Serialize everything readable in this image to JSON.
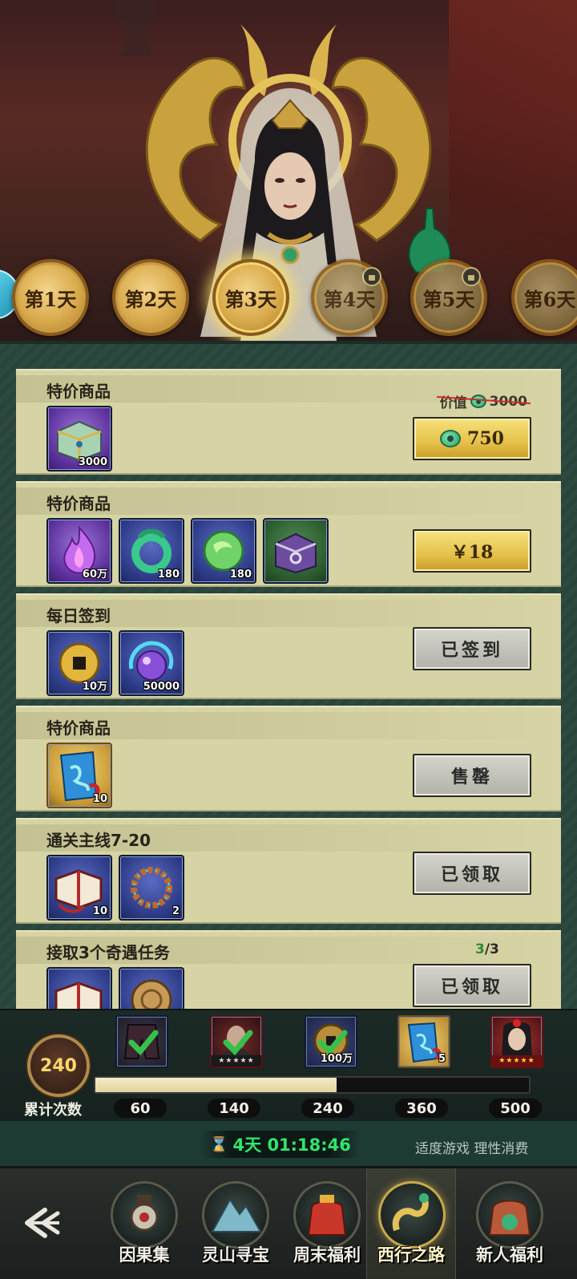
{
  "days": [
    {
      "label": "第1天",
      "state": "claimed"
    },
    {
      "label": "第2天",
      "state": "claimed"
    },
    {
      "label": "第3天",
      "state": "active"
    },
    {
      "label": "第4天",
      "state": "locked"
    },
    {
      "label": "第5天",
      "state": "locked"
    },
    {
      "label": "第6天",
      "state": "locked"
    }
  ],
  "tasks": [
    {
      "title": "特价商品",
      "original_price_label": "价值",
      "original_price_value": "3000",
      "items": [
        {
          "icon": "jade-chest-icon",
          "qty": "3000"
        }
      ],
      "button": {
        "label": "750",
        "style": "gold",
        "currency_icon": "jade-coin-icon"
      }
    },
    {
      "title": "特价商品",
      "items": [
        {
          "icon": "purple-flame-icon",
          "qty": "60万"
        },
        {
          "icon": "jade-dragon-ring-icon",
          "qty": "180"
        },
        {
          "icon": "jade-orb-icon",
          "qty": "180"
        },
        {
          "icon": "purple-chest-icon",
          "qty": ""
        }
      ],
      "button": {
        "label": "￥18",
        "style": "gold"
      }
    },
    {
      "title": "每日签到",
      "items": [
        {
          "icon": "copper-coin-icon",
          "qty": "10万"
        },
        {
          "icon": "spirit-orb-icon",
          "qty": "50000"
        }
      ],
      "button": {
        "label": "已签到",
        "style": "gray"
      }
    },
    {
      "title": "特价商品",
      "items": [
        {
          "icon": "blue-scroll-icon",
          "qty": "10"
        }
      ],
      "button": {
        "label": "售罄",
        "style": "gray"
      }
    },
    {
      "title": "通关主线7-20",
      "items": [
        {
          "icon": "book-icon",
          "qty": "10"
        },
        {
          "icon": "bead-bracelet-icon",
          "qty": "2"
        }
      ],
      "button": {
        "label": "已领取",
        "style": "gray"
      }
    },
    {
      "title": "接取3个奇遇任务",
      "progress_done": "3",
      "progress_total": "/3",
      "items": [
        {
          "icon": "book-icon",
          "qty": ""
        },
        {
          "icon": "bronze-mirror-icon",
          "qty": ""
        }
      ],
      "button": {
        "label": "已领取",
        "style": "gray"
      }
    }
  ],
  "milestones": {
    "count": "240",
    "count_label": "累计次数",
    "progress_fraction": 0.556,
    "thresholds": [
      "60",
      "140",
      "240",
      "360",
      "500"
    ],
    "rewards": [
      {
        "icon": "armor-pants-icon",
        "claimed": true,
        "qty": ""
      },
      {
        "icon": "hero-portrait-icon",
        "claimed": true,
        "stars": "★★★★★"
      },
      {
        "icon": "copper-coin-icon",
        "claimed": true,
        "qty": "100万"
      },
      {
        "icon": "blue-scroll-icon",
        "claimed": false,
        "qty": "5"
      },
      {
        "icon": "hero-portrait-icon",
        "claimed": false,
        "stars": "★★★★★"
      }
    ]
  },
  "timer": {
    "text": "4天 01:18:46"
  },
  "notice": "适度游戏 理性消费",
  "nav": [
    {
      "label": "因果集",
      "icon": "karma-icon"
    },
    {
      "label": "灵山寻宝",
      "icon": "mountain-icon"
    },
    {
      "label": "周末福利",
      "icon": "gift-bag-icon"
    },
    {
      "label": "西行之路",
      "icon": "dragon-icon",
      "active": true
    },
    {
      "label": "新人福利",
      "icon": "newbie-bag-icon"
    }
  ],
  "colors": {
    "accent_gold": "#e5c14a",
    "timer_green": "#34e36a",
    "card_bg": "#d6d3a4"
  }
}
